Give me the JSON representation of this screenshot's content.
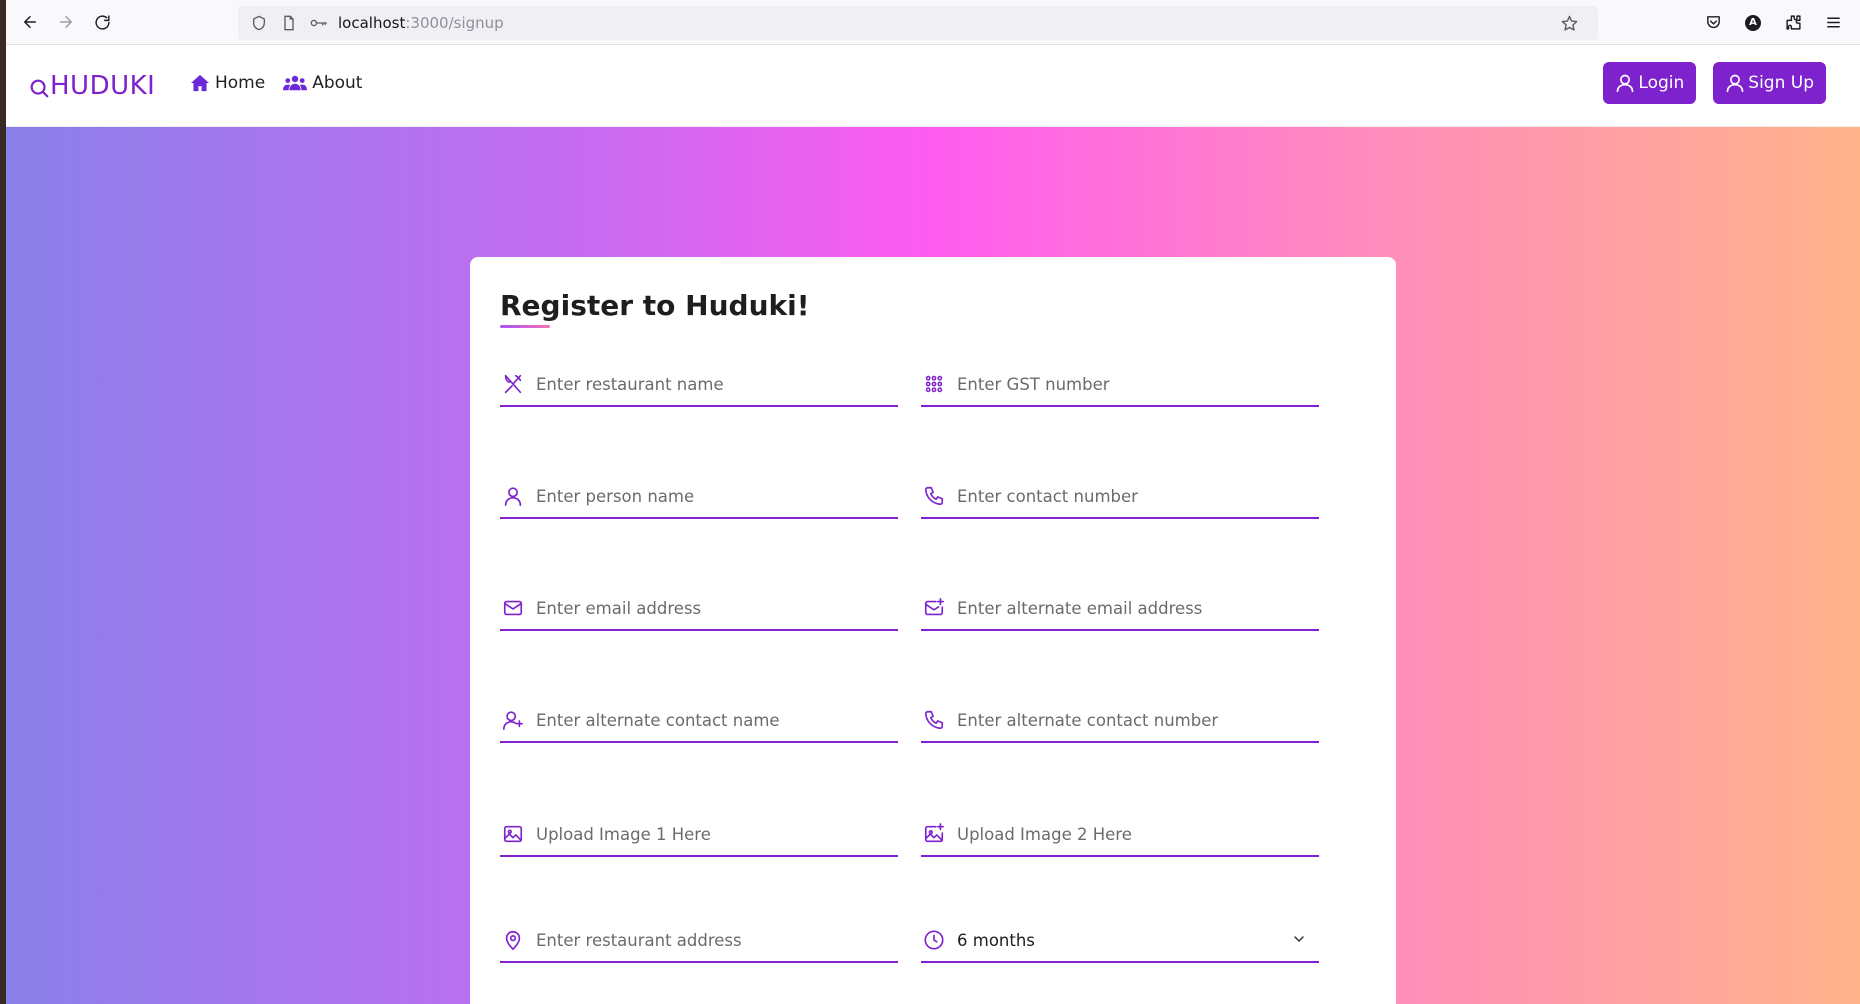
{
  "browser": {
    "url_host": "localhost",
    "url_path": ":3000/signup"
  },
  "navbar": {
    "brand": "HUDUKI",
    "links": [
      {
        "label": "Home",
        "icon": "home-icon"
      },
      {
        "label": "About",
        "icon": "users-icon"
      }
    ],
    "login_label": "Login",
    "signup_label": "Sign Up"
  },
  "form": {
    "title": "Register to Huduki!",
    "fields": {
      "restaurant_name": {
        "placeholder": "Enter restaurant name",
        "icon": "utensils-icon"
      },
      "gst_number": {
        "placeholder": "Enter GST number",
        "icon": "grid-dots-icon"
      },
      "person_name": {
        "placeholder": "Enter person name",
        "icon": "user-icon"
      },
      "contact_number": {
        "placeholder": "Enter contact number",
        "icon": "phone-icon"
      },
      "email": {
        "placeholder": "Enter email address",
        "icon": "mail-icon"
      },
      "alt_email": {
        "placeholder": "Enter alternate email address",
        "icon": "mail-plus-icon"
      },
      "alt_contact_name": {
        "placeholder": "Enter alternate contact name",
        "icon": "user-plus-icon"
      },
      "alt_contact_number": {
        "placeholder": "Enter alternate contact number",
        "icon": "phone-icon"
      },
      "image1": {
        "placeholder": "Upload Image 1 Here",
        "icon": "image-icon"
      },
      "image2": {
        "placeholder": "Upload Image 2 Here",
        "icon": "image-plus-icon"
      },
      "address": {
        "placeholder": "Enter restaurant address",
        "icon": "map-pin-icon"
      },
      "duration": {
        "value": "6 months",
        "icon": "clock-icon"
      }
    }
  },
  "colors": {
    "accent": "#7e22ce",
    "gradient": [
      "#8a80e9",
      "#c36cf0",
      "#ff5cf0",
      "#ff8bbd",
      "#ffb38a"
    ]
  }
}
